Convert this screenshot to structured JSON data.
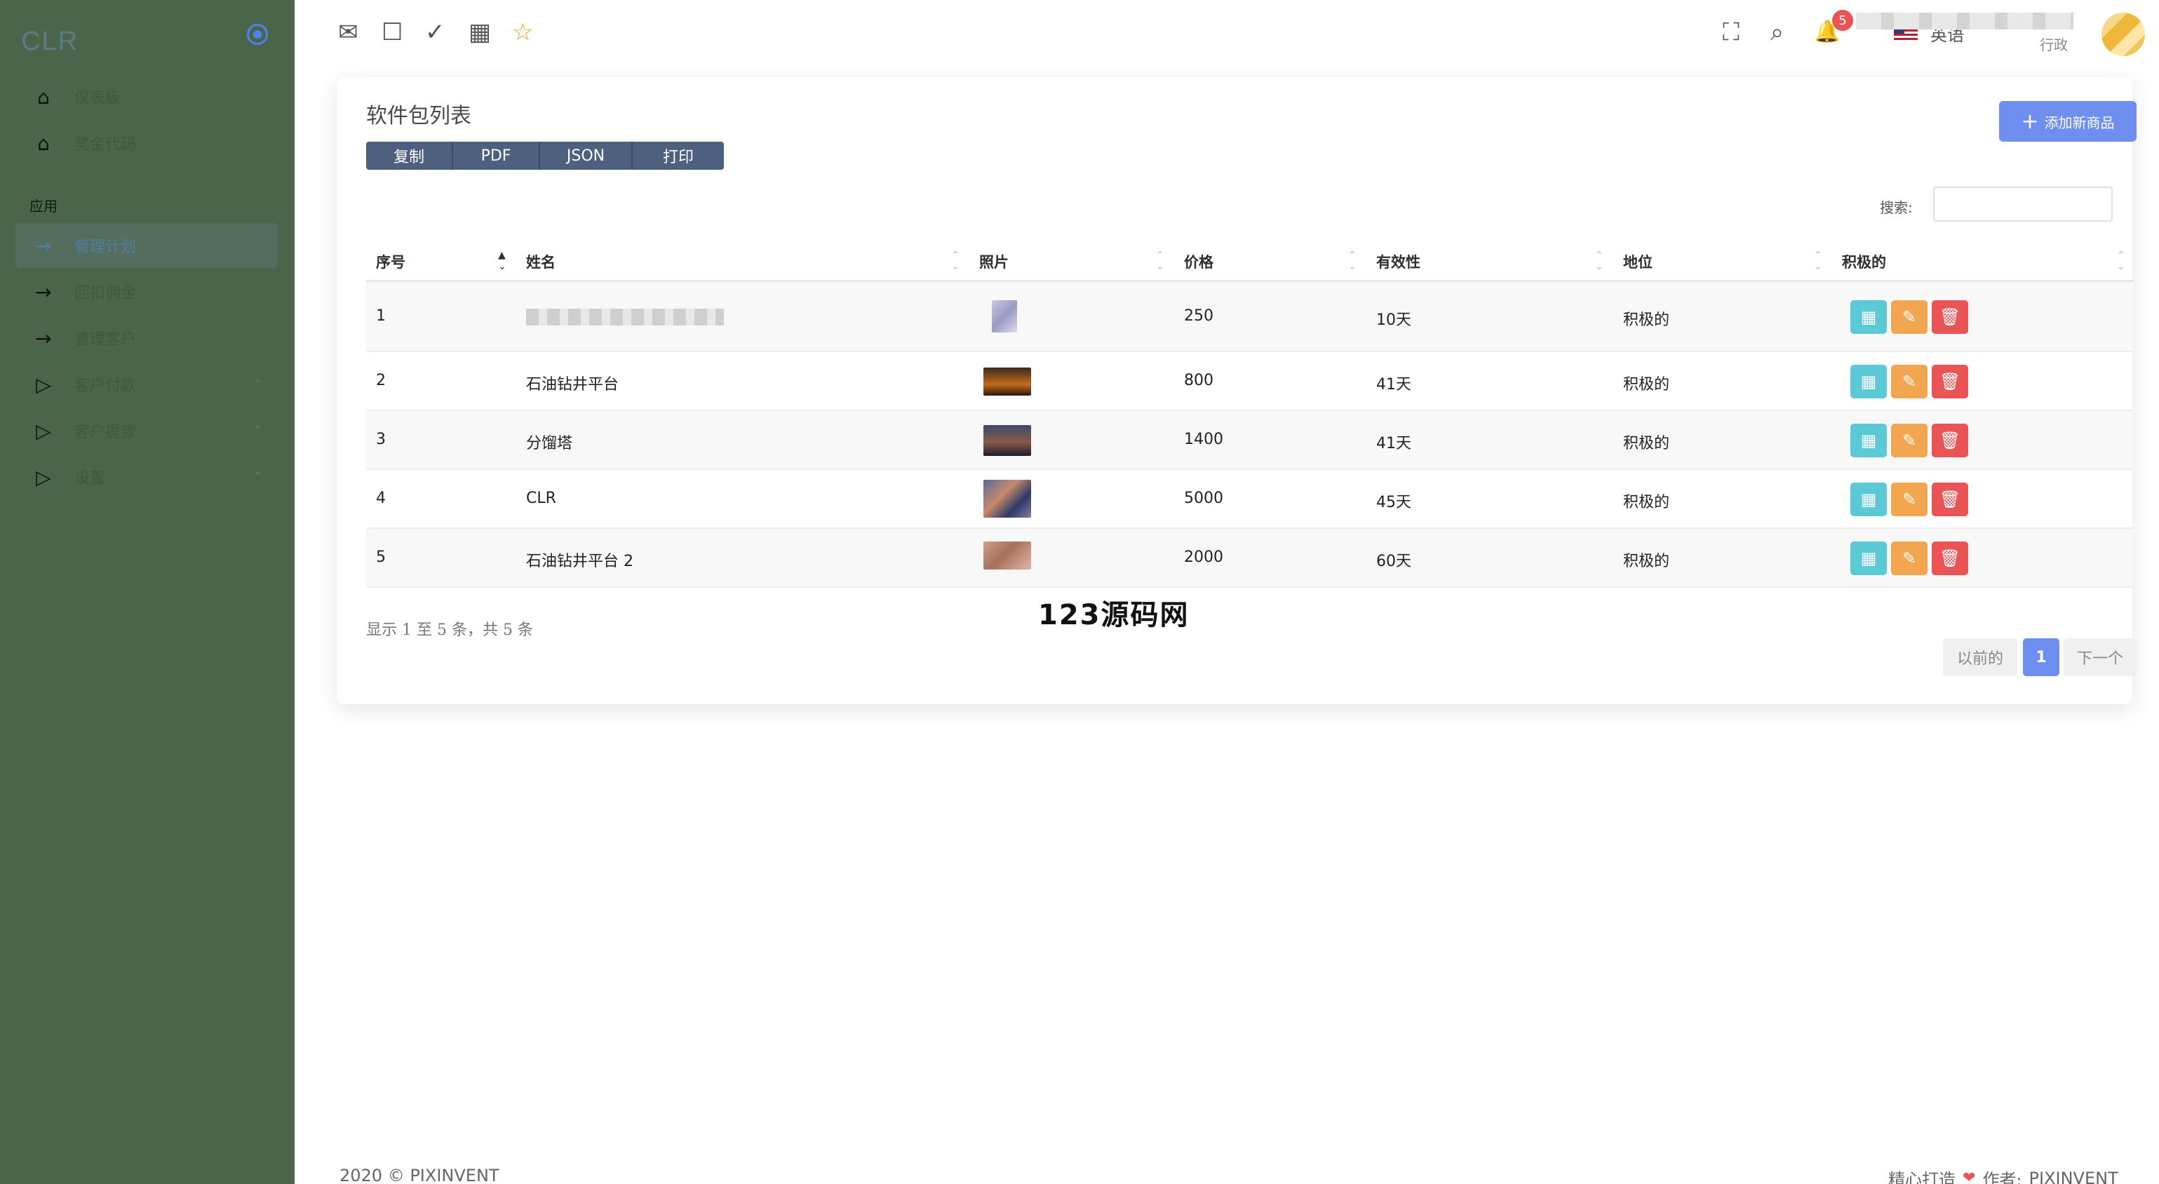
{
  "sidebar": {
    "brand": "CLR",
    "menu": [
      {
        "label": "仪表板",
        "icon": "⌂"
      },
      {
        "label": "奖金代码",
        "icon": "⌂"
      }
    ],
    "section_title": "应用",
    "apps": [
      {
        "label": "管理计划",
        "icon": "→",
        "active": true
      },
      {
        "label": "回扣佣金",
        "icon": "→"
      },
      {
        "label": "管理客户",
        "icon": "→"
      },
      {
        "label": "客户付款",
        "icon": "▷",
        "caret": "⌃"
      },
      {
        "label": "客户提款",
        "icon": "▷",
        "caret": "⌃"
      },
      {
        "label": "设置",
        "icon": "▷",
        "caret": "⌃"
      }
    ]
  },
  "topbar": {
    "icons": {
      "mail": "✉",
      "chat": "☐",
      "todo": "✓",
      "calendar": "▦",
      "star": "☆",
      "fullscreen": "⛶",
      "search": "⌕",
      "bell": "🔔"
    },
    "language": "英语",
    "notification_count": "5",
    "user_role": "行政"
  },
  "card": {
    "title": "软件包列表",
    "export_buttons": [
      "复制",
      "PDF",
      "JSON",
      "打印"
    ],
    "add_button": "添加新商品",
    "search_label": "搜索:",
    "columns": [
      "序号",
      "姓名",
      "照片",
      "价格",
      "有效性",
      "地位",
      "积极的"
    ],
    "rows": [
      {
        "id": "1",
        "name": "",
        "price": "250",
        "validity": "10天",
        "status": "积极的"
      },
      {
        "id": "2",
        "name": "石油钻井平台",
        "price": "800",
        "validity": "41天",
        "status": "积极的"
      },
      {
        "id": "3",
        "name": "分馏塔",
        "price": "1400",
        "validity": "41天",
        "status": "积极的"
      },
      {
        "id": "4",
        "name": "CLR",
        "price": "5000",
        "validity": "45天",
        "status": "积极的"
      },
      {
        "id": "5",
        "name": "石油钻井平台 2",
        "price": "2000",
        "validity": "60天",
        "status": "积极的"
      }
    ],
    "info": "显示 1 至 5 条，共 5 条",
    "watermark": "123源码网",
    "pagination": {
      "prev": "以前的",
      "current": "1",
      "next": "下一个"
    }
  },
  "footer": {
    "copyright": "2020 © PIXINVENT",
    "crafted": "精心打造",
    "heart": "❤",
    "author_label": "作者:",
    "author": "PIXINVENT"
  },
  "colors": {
    "sidebar": "#4b654b",
    "primary": "#6f8ff0",
    "info": "#5ccad6",
    "warning": "#f2a650",
    "danger": "#ea5455"
  }
}
